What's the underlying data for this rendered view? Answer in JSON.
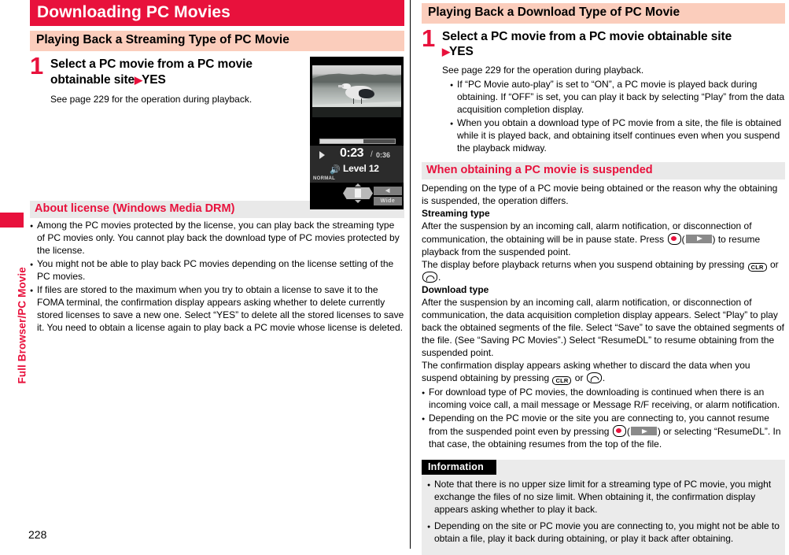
{
  "page": {
    "number": "228",
    "side_tab_label": "Full Browser/PC Movie",
    "accent_red": "#e8113c",
    "section_band": "#fbcdbc",
    "subsection_band": "#e9e9e9",
    "info_band": "#ebebeb"
  },
  "left": {
    "chapter_title": "Downloading PC Movies",
    "section_title": "Playing Back a Streaming Type of PC Movie",
    "step": {
      "number": "1",
      "head_line1": "Select a PC movie from a PC movie",
      "head_line2": "obtainable site",
      "arrow": "▶",
      "head_line2_tail": "YES",
      "body": "See page 229 for the operation during playback."
    },
    "subsection_title": "About license (Windows Media DRM)",
    "bullets": [
      "Among the PC movies protected by the license, you can play back the streaming type of PC movies only. You cannot play back the download type of PC movies protected by the license.",
      "You might not be able to play back PC movies depending on the license setting of the PC movies.",
      "If files are stored to the maximum when you try to obtain a license to save it to the FOMA terminal, the confirmation display appears asking whether to delete currently stored licenses to save a new one. Select “YES” to delete all the stored licenses to save it. You need to obtain a license again to play back a PC movie whose license is deleted."
    ]
  },
  "phone_screenshot": {
    "time_elapsed": "0:23",
    "time_separator": "/",
    "time_total": "0:36",
    "volume_label": "Level 12",
    "mode_label": "NORMAL",
    "softkey_top": "◀",
    "softkey_bottom": "Wide"
  },
  "right": {
    "section_title": "Playing Back a Download Type of PC Movie",
    "step": {
      "number": "1",
      "head_line1": "Select a PC movie from a PC movie obtainable site",
      "arrow": "▶",
      "head_line2": "YES",
      "body": "See page 229 for the operation during playback.",
      "bullets": [
        "If “PC Movie auto-play” is set to “ON”, a PC movie is played back during obtaining. If “OFF” is set, you can play it back by selecting “Play” from the data acquisition completion display.",
        "When you obtain a download type of PC movie from a site, the file is obtained while it is played back, and obtaining itself continues even when you suspend the playback midway."
      ]
    },
    "subsection_title": "When obtaining a PC movie is suspended",
    "intro": "Depending on the type of a PC movie being obtained or the reason why the obtaining is suspended, the operation differs.",
    "streaming_heading": "Streaming type",
    "streaming_p1_a": "After the suspension by an incoming call, alarm notification, or disconnection of communication, the obtaining will be in pause state. Press ",
    "streaming_p1_b": "(",
    "streaming_p1_c": ") to resume playback from the suspended point.",
    "streaming_p2_a": "The display before playback returns when you suspend obtaining by pressing ",
    "streaming_p2_or": " or ",
    "streaming_p2_end": ".",
    "download_heading": "Download type",
    "download_p1": "After the suspension by an incoming call, alarm notification, or disconnection of communication, the data acquisition completion display appears. Select “Play” to play back the obtained segments of the file. Select “Save” to save the obtained segments of the file. (See “Saving PC Movies”.) Select “ResumeDL” to resume obtaining from the suspended point.",
    "download_p2_a": "The confirmation display appears asking whether to discard the data when you suspend obtaining by pressing ",
    "download_p2_or": " or ",
    "download_p2_end": ".",
    "download_bullets_1": "For download type of PC movies, the downloading is continued when there is  an incoming voice call, a mail message or Message R/F receiving, or alarm notification.",
    "download_bullet2_a": "Depending on the PC movie or the site you are connecting to, you cannot resume from the suspended point even by pressing ",
    "download_bullet2_b": "(",
    "download_bullet2_c": ") or selecting “ResumeDL”. In that case, the obtaining resumes from the top of the file.",
    "clr_key_label": "CLR",
    "information": {
      "title": "Information",
      "bullets": [
        "Note that there is no upper size limit for a streaming type of PC movie, you might exchange the files of no size limit. When obtaining it, the confirmation display appears asking whether to play it back.",
        "Depending on the site or PC movie you are connecting to, you might not be able to obtain a file, play it back during obtaining, or play it back after obtaining."
      ]
    }
  }
}
